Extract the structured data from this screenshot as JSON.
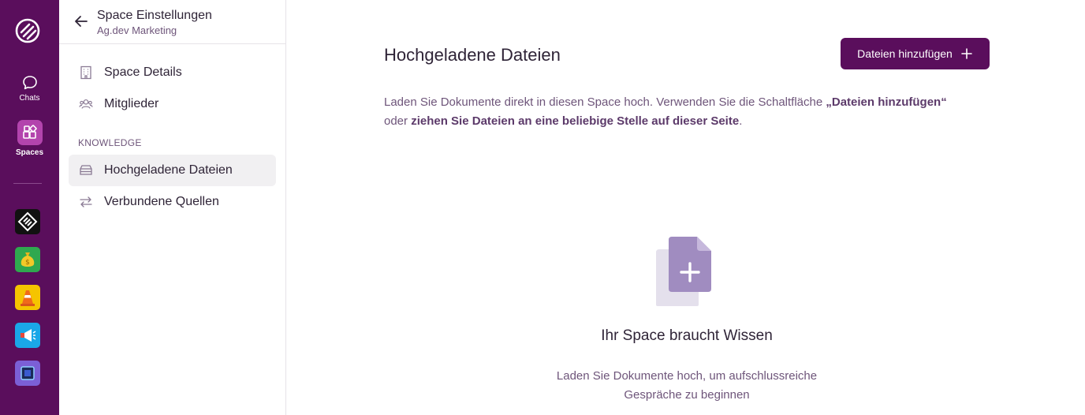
{
  "rail": {
    "chats_label": "Chats",
    "spaces_label": "Spaces",
    "apps": [
      {
        "icon": "diamond-logo-icon",
        "color": "#111111"
      },
      {
        "icon": "money-bag-icon",
        "color": "#2fa84f"
      },
      {
        "icon": "traffic-cone-icon",
        "color": "#f5c400"
      },
      {
        "icon": "megaphone-icon",
        "color": "#1aa7e8"
      },
      {
        "icon": "chip-icon",
        "color": "#7b5fd6"
      }
    ]
  },
  "sidebar": {
    "title": "Space Einstellungen",
    "subtitle": "Ag.dev Marketing",
    "items": [
      {
        "label": "Space Details",
        "icon": "building-icon"
      },
      {
        "label": "Mitglieder",
        "icon": "users-icon"
      }
    ],
    "section_label": "KNOWLEDGE",
    "knowledge_items": [
      {
        "label": "Hochgeladene Dateien",
        "icon": "storage-icon",
        "active": true
      },
      {
        "label": "Verbundene Quellen",
        "icon": "arrows-exchange-icon"
      }
    ]
  },
  "main": {
    "title": "Hochgeladene Dateien",
    "add_button": "Dateien hinzufügen",
    "description": {
      "part1": "Laden Sie Dokumente direkt in diesen Space hoch. Verwenden Sie die Schaltfläche ",
      "bold1": "„Dateien hinzufügen“",
      "part2": " oder ",
      "bold2": "ziehen Sie Dateien an eine beliebige Stelle auf dieser Seite",
      "part3": "."
    },
    "empty_title": "Ihr Space braucht Wissen",
    "empty_sub_line1": "Laden Sie Dokumente hoch, um aufschlussreiche",
    "empty_sub_line2": "Gespräche zu beginnen"
  },
  "colors": {
    "brand": "#5a0e5c",
    "accent": "#b344ad",
    "muted_text": "#6e557a",
    "empty_icon": "#a08cc0"
  }
}
